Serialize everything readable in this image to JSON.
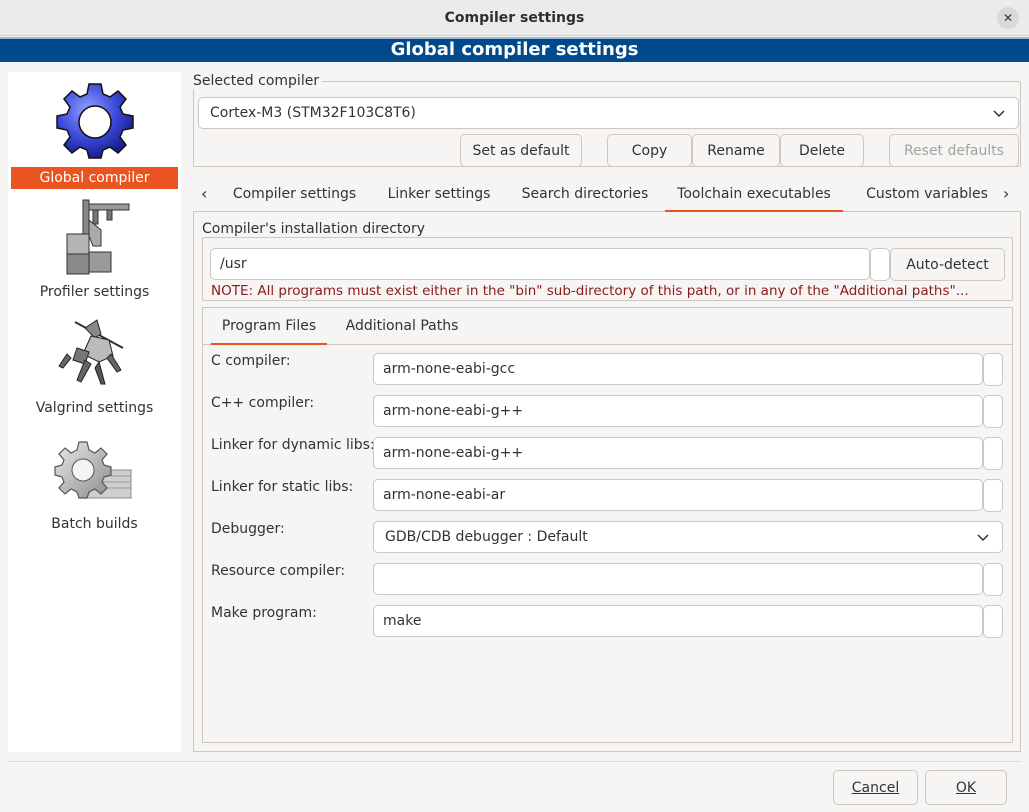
{
  "window": {
    "title": "Compiler settings"
  },
  "banner": {
    "title": "Global compiler settings"
  },
  "sidebar": {
    "items": [
      {
        "label": "Global compiler settings",
        "icon": "gear-icon",
        "selected": true
      },
      {
        "label": "Profiler settings",
        "icon": "profiler-icon",
        "selected": false
      },
      {
        "label": "Valgrind settings",
        "icon": "valgrind-icon",
        "selected": false
      },
      {
        "label": "Batch builds",
        "icon": "batch-builds-icon",
        "selected": false
      }
    ]
  },
  "compiler": {
    "group_label": "Selected compiler",
    "selected": "Cortex-M3 (STM32F103C8T6)",
    "buttons": {
      "set_default": "Set as default",
      "copy": "Copy",
      "rename": "Rename",
      "delete": "Delete",
      "reset_defaults": "Reset defaults"
    }
  },
  "tabs": [
    {
      "label": "Compiler settings"
    },
    {
      "label": "Linker settings"
    },
    {
      "label": "Search directories"
    },
    {
      "label": "Toolchain executables",
      "active": true
    },
    {
      "label": "Custom variables"
    }
  ],
  "install_dir": {
    "group_label": "Compiler's installation directory",
    "value": "/usr",
    "auto_detect": "Auto-detect",
    "note": "NOTE: All programs must exist either in the \"bin\" sub-directory of this path, or in any of the \"Additional paths\"..."
  },
  "subtabs": [
    {
      "label": "Program Files",
      "active": true
    },
    {
      "label": "Additional Paths"
    }
  ],
  "programs": {
    "c_compiler": {
      "label": "C compiler:",
      "value": "arm-none-eabi-gcc"
    },
    "cpp_compiler": {
      "label": "C++ compiler:",
      "value": "arm-none-eabi-g++"
    },
    "linker_dynamic": {
      "label": "Linker for dynamic libs:",
      "value": "arm-none-eabi-g++"
    },
    "linker_static": {
      "label": "Linker for static libs:",
      "value": "arm-none-eabi-ar"
    },
    "debugger": {
      "label": "Debugger:",
      "value": "GDB/CDB debugger : Default"
    },
    "resource_compiler": {
      "label": "Resource compiler:",
      "value": ""
    },
    "make_program": {
      "label": "Make program:",
      "value": "make"
    }
  },
  "footer": {
    "cancel": "Cancel",
    "ok": "OK"
  },
  "colors": {
    "accent": "#e95420",
    "banner": "#004a8c",
    "note": "#8b1a1a"
  }
}
